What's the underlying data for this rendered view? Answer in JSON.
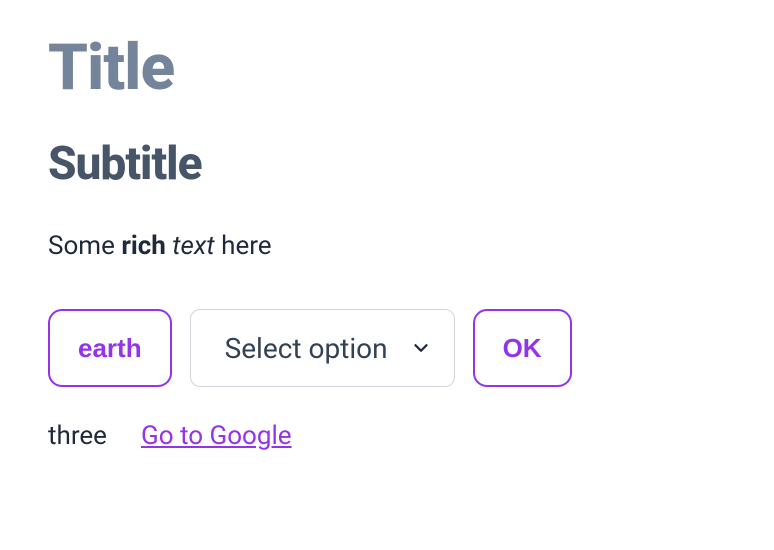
{
  "headings": {
    "title": "Title",
    "subtitle": "Subtitle"
  },
  "richText": {
    "prefix": "Some ",
    "bold": "rich",
    "space": " ",
    "italic": "text",
    "suffix": " here"
  },
  "controls": {
    "pillLabel": "earth",
    "selectPlaceholder": "Select option",
    "okLabel": "OK"
  },
  "bottom": {
    "plain": "three",
    "linkText": "Go to Google"
  },
  "colors": {
    "accent": "#9333ea",
    "headingMuted": "#74859b",
    "headingDark": "#475569",
    "text": "#1e293b",
    "border": "#d1d5db"
  }
}
